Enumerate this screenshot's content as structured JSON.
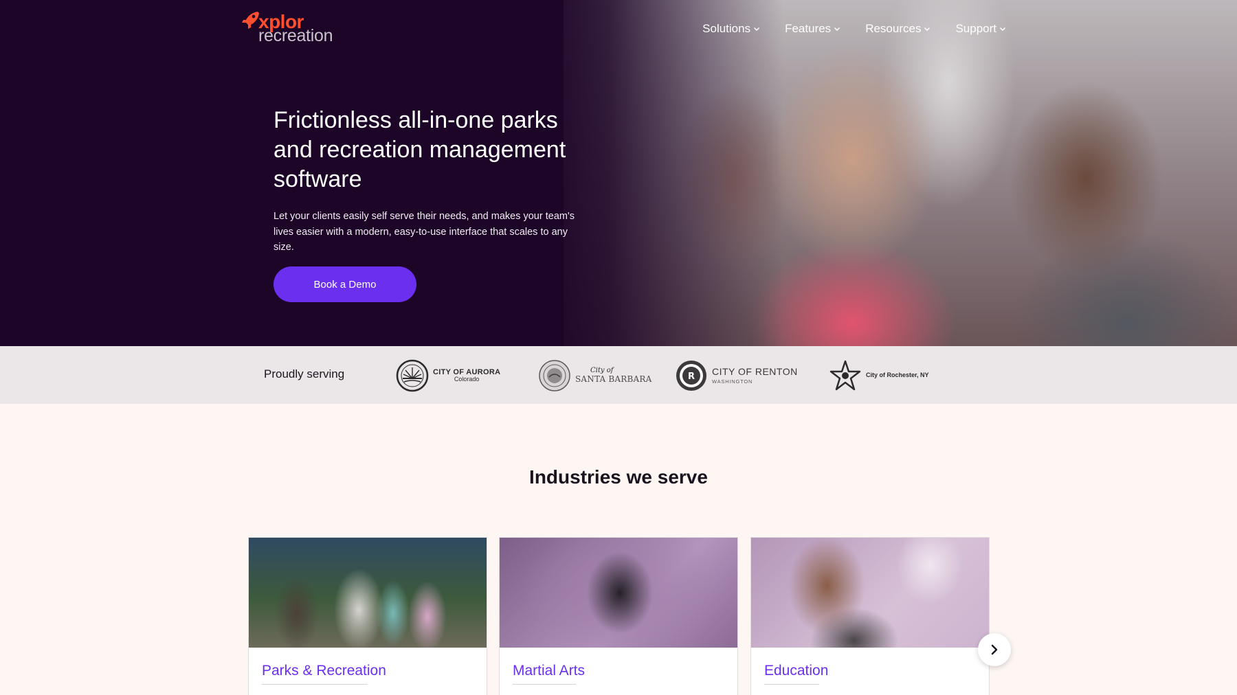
{
  "brand": {
    "logo_top": "xplor",
    "logo_bottom": "recreation",
    "accent_color": "#ff4f2e",
    "primary_color": "#6b2ff0",
    "hero_bg_color": "#1d0528"
  },
  "nav": {
    "items": [
      {
        "label": "Solutions",
        "icon": "chevron-down-icon"
      },
      {
        "label": "Features",
        "icon": "chevron-down-icon"
      },
      {
        "label": "Resources",
        "icon": "chevron-down-icon"
      },
      {
        "label": "Support",
        "icon": "chevron-down-icon"
      }
    ]
  },
  "hero": {
    "title": "Frictionless all-in-one parks and recreation management software",
    "description": "Let your clients easily self serve their needs, and makes your team's lives easier with a modern, easy-to-use interface that scales to any size.",
    "cta_label": "Book a Demo"
  },
  "clients": {
    "label": "Proudly serving",
    "logos": [
      {
        "main": "CITY OF AURORA",
        "sub": "Colorado"
      },
      {
        "small": "City of",
        "main": "SANTA BARBARA"
      },
      {
        "main": "CITY OF RENTON",
        "sub": "WASHINGTON"
      },
      {
        "main": "City of Rochester, NY"
      }
    ]
  },
  "industries": {
    "title": "Industries we serve",
    "cards": [
      {
        "label": "Parks & Recreation"
      },
      {
        "label": "Martial Arts"
      },
      {
        "label": "Education"
      }
    ],
    "next_icon": "chevron-right-icon"
  }
}
